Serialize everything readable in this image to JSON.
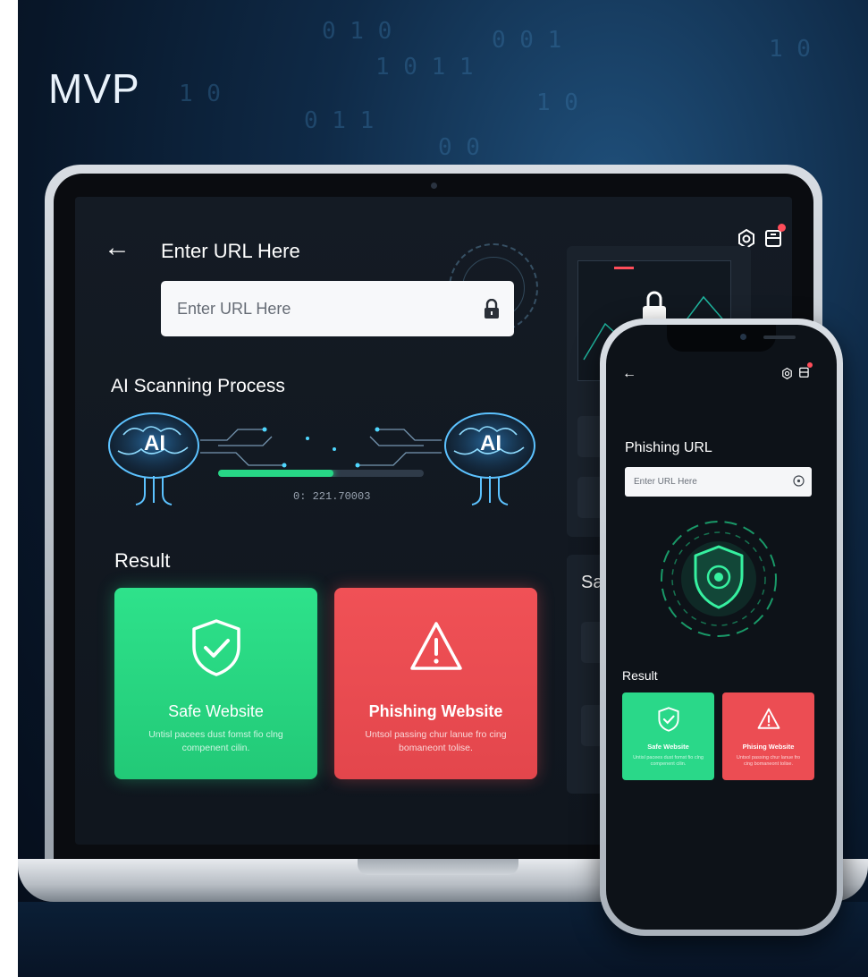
{
  "header": {
    "title": "MVP"
  },
  "laptop": {
    "url_section": {
      "heading": "Enter URL Here",
      "input_placeholder": "Enter URL Here",
      "input_value": ""
    },
    "scan": {
      "title": "AI Scanning Process",
      "left_brain_label": "AI",
      "right_brain_label": "AI",
      "progress_fraction": 0.56,
      "progress_readout": "0: 221.70003"
    },
    "result": {
      "title": "Result",
      "safe_card": {
        "title": "Safe Website",
        "text": "Untisl pacees dust fomst fio clng compenent cilin."
      },
      "phishing_card": {
        "title": "Phishing Website",
        "text": "Untsol passing chur lanue fro cing bomaneont tolise."
      }
    },
    "side_panel": {
      "label": "Safe"
    }
  },
  "phone": {
    "title": "Phishing URL",
    "input_placeholder": "Enter URL Here",
    "result": {
      "title": "Result",
      "safe_card": {
        "title": "Safe Website",
        "text": "Untisl pacees dust fomst fio clng compenent cilin."
      },
      "phishing_card": {
        "title": "Phising Website",
        "text": "Untsol passing chur lanue fro cing bomaneont tolise."
      }
    }
  },
  "colors": {
    "safe": "#27d686",
    "danger": "#f05156",
    "background": "#0a1a2e",
    "screen": "#121820"
  },
  "icons": [
    "back-arrow-icon",
    "lock-icon",
    "gear-icon",
    "tray-icon",
    "brain-icon",
    "shield-check-icon",
    "warning-triangle-icon",
    "shield-icon",
    "clock-icon"
  ]
}
